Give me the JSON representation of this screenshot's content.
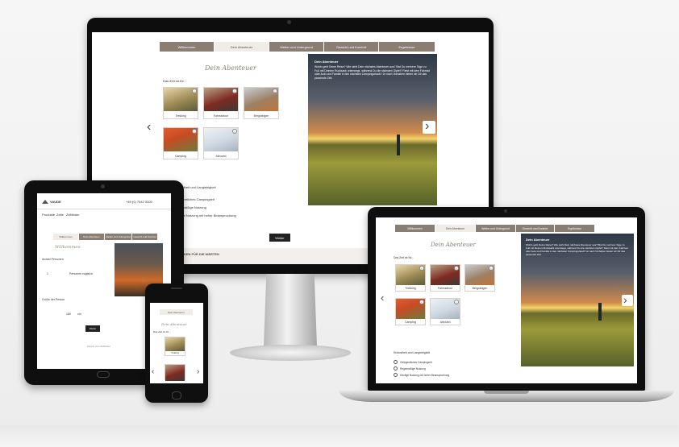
{
  "tabs": [
    "Willkommen",
    "Dein Abenteuer",
    "Wetter und Untergrund",
    "Gewicht und Komfort",
    "Ergebnisse"
  ],
  "active_tab_index": 1,
  "section_title": "Dein Abenteuer",
  "question": "Das Zelt ist für...",
  "options": [
    {
      "label": "Trekking",
      "icon": "trekking-photo"
    },
    {
      "label": "Fahrradtour",
      "icon": "bike-tour-photo"
    },
    {
      "label": "Bergsteigen",
      "icon": "mountaineering-photo"
    },
    {
      "label": "Camping",
      "icon": "camping-photo"
    },
    {
      "label": "Allround",
      "icon": "allround-photo"
    }
  ],
  "description": {
    "heading": "Dein Abenteuer",
    "text": "Wohin geht Deine Reise? Wie sieht Dein nächstes Abenteuer aus? Bist Du mehrere Tage zu Fuß mit Deinem Rucksack unterwegs, während Du die nächsten Gipfel? Reist mit dem Fahrrad oder Auto und Familie in den nächsten Campingurlaub? Je nach Vorhaben bieten wir Dir das passende Zelt."
  },
  "durability": {
    "title": "Robustheit und Langlebigkeit",
    "options": [
      "Gelegentliches Campingzelt",
      "Regelmäßige Nutzung",
      "Häufige Nutzung mit hoher Beanspruchung"
    ]
  },
  "next_button": "Weiter",
  "footer_heading": "…KEN FÜR DIE MÄRTEN",
  "tablet": {
    "brand": "VAUDE",
    "phone": "+49 (0) 7542 5300",
    "nav": [
      "Produkte",
      "Zelte",
      "Zeltfinder"
    ],
    "section_title": "Willkommen",
    "question_1": "Anzahl Personen",
    "value_1": "1",
    "unit_1": "Personen zugleich",
    "question_2": "Größe der Person",
    "value_2": "180",
    "unit_2": "cm",
    "next_button": "Weiter",
    "footer": "Zurück zum Zeltfinder"
  },
  "phone": {
    "tab": "Dein Abenteuer",
    "title": "Dein Abenteuer",
    "question": "Das Zelt ist für...",
    "option": "Trekking"
  }
}
